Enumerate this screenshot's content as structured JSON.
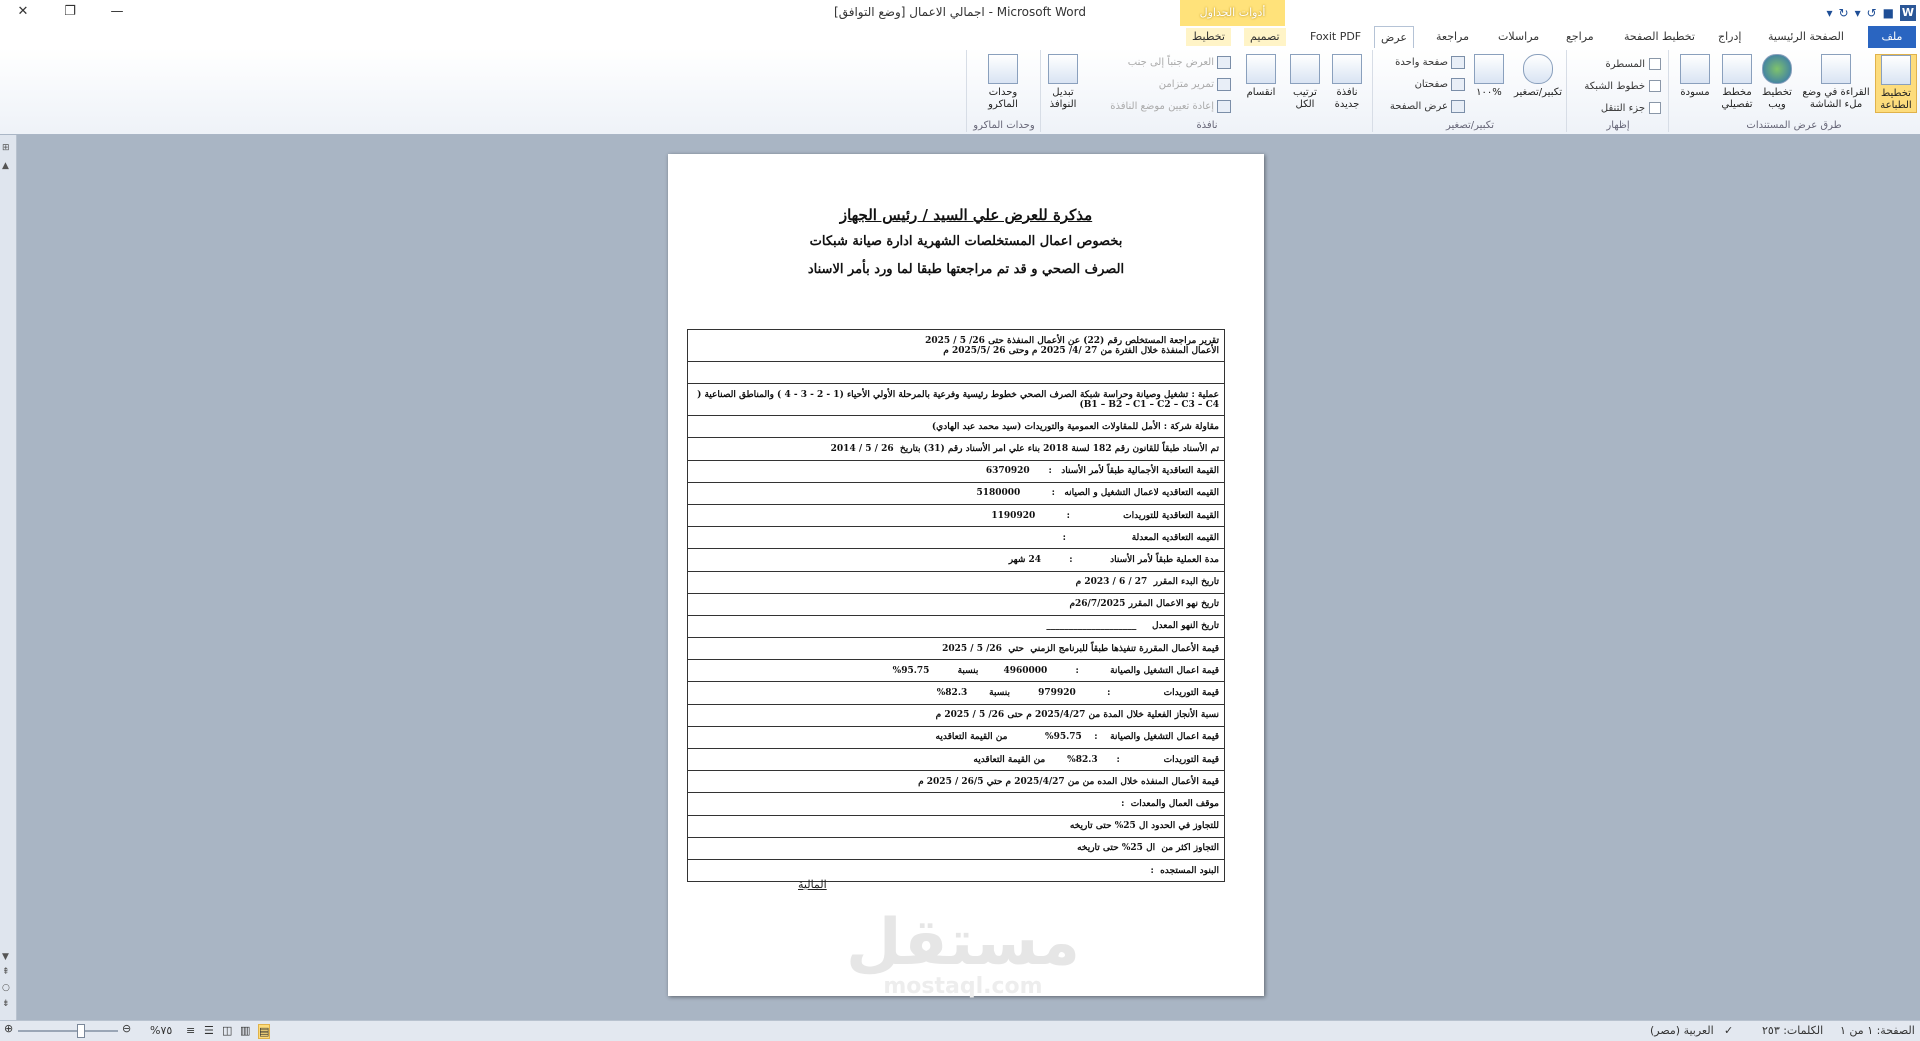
{
  "titlebar": {
    "title": "اجمالي الاعمال [وضع التوافق] - Microsoft Word",
    "context_tab_group": "أدوات الجداول"
  },
  "tabs": {
    "file": "ملف",
    "home": "الصفحة الرئيسية",
    "insert": "إدراج",
    "page_layout": "تخطيط الصفحة",
    "references": "مراجع",
    "mailings": "مراسلات",
    "review": "مراجعة",
    "view": "عرض",
    "foxit": "Foxit PDF",
    "design": "تصميم",
    "layout": "تخطيط"
  },
  "ribbon": {
    "document_views": {
      "name": "طرق عرض المستندات",
      "print_layout": "تخطيط\nالطباعة",
      "full_screen": "القراءة في وضع\nملء الشاشة",
      "web_layout": "تخطيط\nويب",
      "outline": "مخطط\nتفصيلي",
      "draft": "مسودة"
    },
    "show": {
      "name": "إظهار",
      "ruler": "المسطرة",
      "gridlines": "خطوط الشبكة",
      "nav_pane": "جزء التنقل"
    },
    "zoom": {
      "name": "تكبير/تصغير",
      "zoom": "تكبير/تصغير",
      "hundred": "١٠٠%",
      "one_page": "صفحة واحدة",
      "two_pages": "صفحتان",
      "page_width": "عرض الصفحة"
    },
    "window": {
      "name": "نافذة",
      "new_window": "نافذة\nجديدة",
      "arrange_all": "ترتيب\nالكل",
      "split": "انقسام",
      "side_by_side": "العرض جنباً إلى جنب",
      "sync_scroll": "تمرير متزامن",
      "reset_pos": "إعادة تعيين موضع النافذة",
      "switch": "تبديل\nالنوافذ"
    },
    "macros": {
      "name": "وحدات الماكرو",
      "macros": "وحدات\nالماكرو"
    }
  },
  "document": {
    "heading1": "مذكرة للعرض علي السيد / رئيس الجهاز",
    "heading2": "بخصوص اعمال المستخلصات الشهرية ادارة صيانة شبكات",
    "heading3": "الصرف الصحي و قد تم مراجعتها طبقا لما ورد بأمر الاسناد",
    "rows": [
      "تقرير مراجعة المستخلص رقم (22) عن الأعمال المنفذة حتى 26/ 5 / 2025\nالأعمال المنفذة خلال الفترة من 27 /4/ 2025 م وحتى 26 /2025/5 م",
      "",
      "عملية : تشغيل وصيانة وحراسة شبكة الصرف الصحي خطوط رئيسية وفرعية بالمرحلة الأولي الأحياء (1 - 2 - 3 - 4 ) والمناطق الصناعية ( B1 – B2 – C1 – C2 – C3 – C4)",
      "مقاولة شركة : الأمل للمقاولات العمومية والتوريدات (سيد محمد عبد الهادي)",
      "تم الأسناد طبقاً للقانون رقم 182 لسنة 2018 بناء علي امر الأسناد رقم (31) بتاريخ  26 / 5 / 2014",
      "القيمة التعاقدية الأجمالية طبقاً لأمر الأسناد   :      6370920",
      "القيمه التعاقديه لاعمال التشغيل و الصيانه   :          5180000",
      "القيمة التعاقدية للتوريدات                 :          1190920",
      "القيمه التعاقديه المعدلة                     :",
      "مدة العملية طبقاً لأمر الأسناد            :         24 شهر",
      "تاريخ البدء المقرر  27 / 6 / 2023 م",
      "تاريخ نهو الاعمال المقرر 26/7/2025م",
      "تاريخ النهو المعدل     ____________________",
      "قيمة الأعمال المقررة تنفيذها طبقاً للبرنامج الزمني  حتي  26/ 5 / 2025",
      "قيمة اعمال التشغيل والصيانة          :         4960000        بنسبة         95.75%",
      "قيمة التوريدات                 :          979920         بنسبة       82.3%",
      "نسبة الأنجاز الفعلية خلال المدة من 2025/4/27 م حتى 26/ 5 / 2025 م",
      "قيمة اعمال التشغيل والصيانة    :    95.75%            من القيمة التعاقديه",
      "قيمة التوريدات              :      82.3%       من القيمة التعاقديه",
      "قيمة الأعمال المنفذه خلال المده من من 2025/4/27 م حتي 26/5 / 2025 م",
      "موقف العمال والمعدات  :",
      "للتجاوز في الحدود ال 25% حتى تاريخه",
      "التجاوز اكثر من  ال 25% حتى تاريخه",
      "البنود المستجده  :"
    ],
    "footer": "المالية",
    "watermark": "مستقل",
    "watermark_sub": "mostaql.com"
  },
  "status": {
    "page": "الصفحة: ١ من ١",
    "words": "الكلمات: ٢٥٣",
    "language": "العربية (مصر)",
    "zoom": "%٧٥"
  }
}
